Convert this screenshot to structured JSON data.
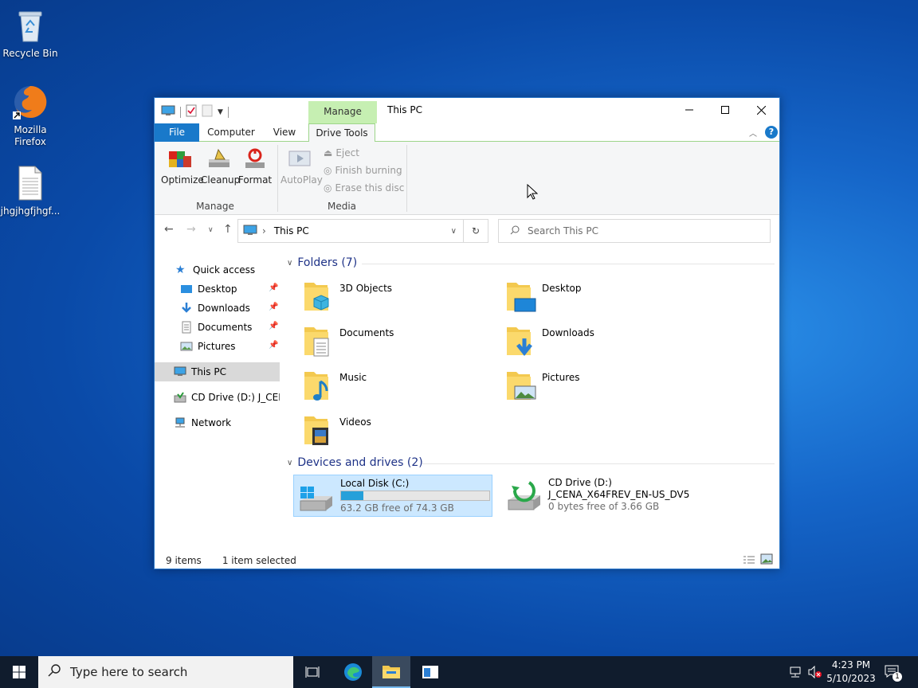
{
  "desktop": {
    "icons": [
      {
        "label": "Recycle Bin"
      },
      {
        "label": "Mozilla Firefox"
      },
      {
        "label": "jhgjhgfjhgf..."
      }
    ]
  },
  "window": {
    "title": "This PC",
    "contextual_tab": "Manage",
    "tabs": {
      "file": "File",
      "computer": "Computer",
      "view": "View",
      "drive_tools": "Drive Tools"
    },
    "ribbon": {
      "optimize": "Optimize",
      "cleanup": "Cleanup",
      "format": "Format",
      "autoplay": "AutoPlay",
      "eject": "Eject",
      "finish_burning": "Finish burning",
      "erase_disc": "Erase this disc",
      "group_manage": "Manage",
      "group_media": "Media"
    },
    "address": {
      "path": "This PC"
    },
    "search": {
      "placeholder": "Search This PC"
    },
    "nav": {
      "quick_access": "Quick access",
      "desktop": "Desktop",
      "downloads": "Downloads",
      "documents": "Documents",
      "pictures": "Pictures",
      "this_pc": "This PC",
      "cd_drive": "CD Drive (D:) J_CENA",
      "network": "Network"
    },
    "folders_header": "Folders (7)",
    "folders": [
      "3D Objects",
      "Desktop",
      "Documents",
      "Downloads",
      "Music",
      "Pictures",
      "Videos"
    ],
    "devices_header": "Devices and drives (2)",
    "drives": [
      {
        "name": "Local Disk (C:)",
        "free": "63.2 GB free of 74.3 GB",
        "used_fraction": 0.15
      },
      {
        "name": "CD Drive (D:)",
        "label": "J_CENA_X64FREV_EN-US_DV5",
        "free": "0 bytes free of 3.66 GB"
      }
    ],
    "status": {
      "items": "9 items",
      "selected": "1 item selected"
    }
  },
  "taskbar": {
    "search_placeholder": "Type here to search",
    "time": "4:23 PM",
    "date": "5/10/2023",
    "notifications": "1"
  },
  "colors": {
    "accent": "#1979ca",
    "manage_tab": "#c6efb2",
    "selection": "#cce8ff",
    "taskbar": "#101c2d"
  }
}
